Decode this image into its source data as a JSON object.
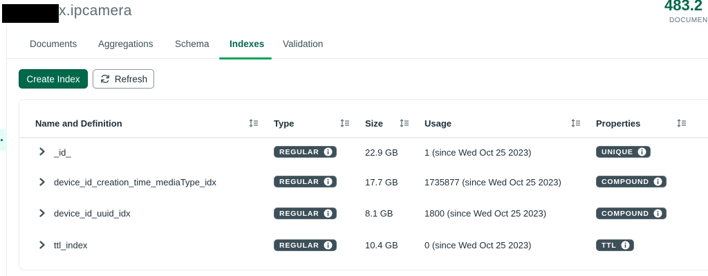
{
  "header": {
    "collection_title": "x.ipcamera",
    "stat_value": "483.2",
    "stat_label": "DOCUMEN"
  },
  "tabs": [
    {
      "label": "Documents"
    },
    {
      "label": "Aggregations"
    },
    {
      "label": "Schema"
    },
    {
      "label": "Indexes",
      "active": true
    },
    {
      "label": "Validation"
    }
  ],
  "toolbar": {
    "create_index_label": "Create Index",
    "refresh_label": "Refresh"
  },
  "table": {
    "columns": [
      "Name and Definition",
      "Type",
      "Size",
      "Usage",
      "Properties"
    ],
    "rows": [
      {
        "name": "_id_",
        "type": "REGULAR",
        "size": "22.9 GB",
        "usage": "1 (since Wed Oct 25 2023)",
        "property": "UNIQUE"
      },
      {
        "name": "device_id_creation_time_mediaType_idx",
        "type": "REGULAR",
        "size": "17.7 GB",
        "usage": "1735877 (since Wed Oct 25 2023)",
        "property": "COMPOUND"
      },
      {
        "name": "device_id_uuid_idx",
        "type": "REGULAR",
        "size": "8.1 GB",
        "usage": "1800 (since Wed Oct 25 2023)",
        "property": "COMPOUND"
      },
      {
        "name": "ttl_index",
        "type": "REGULAR",
        "size": "10.4 GB",
        "usage": "0 (since Wed Oct 25 2023)",
        "property": "TTL"
      }
    ]
  },
  "colors": {
    "accent": "#00684a",
    "tab_underline": "#00a35c",
    "badge_bg": "#3d4f58"
  },
  "icons": {
    "refresh": "refresh-icon",
    "sort": "sort-icon",
    "expand": "chevron-right-icon",
    "info": "info-icon"
  }
}
